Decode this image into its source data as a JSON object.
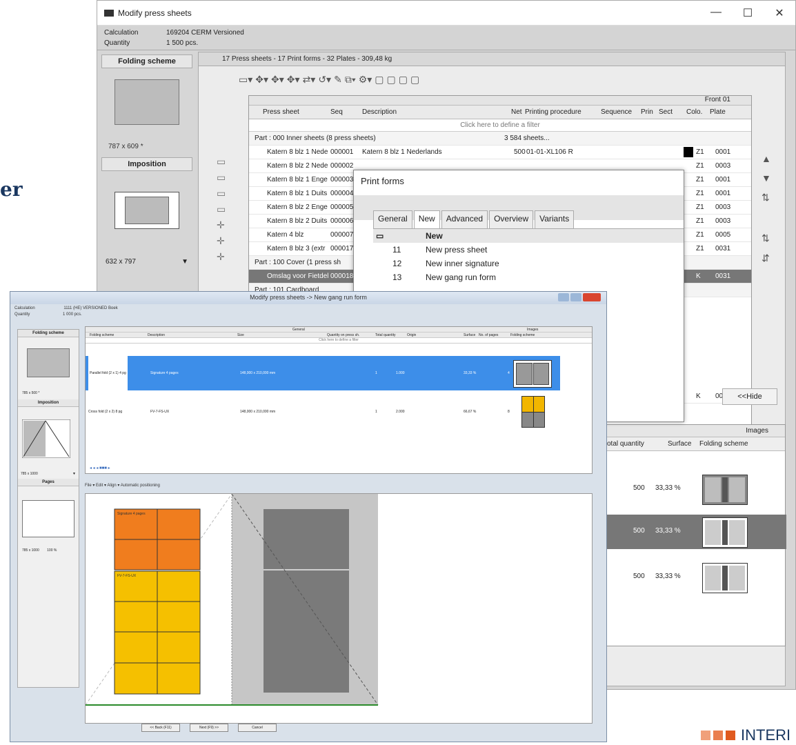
{
  "slide": {
    "partial_heading": "er"
  },
  "brand": {
    "text": "INTERI",
    "colors": [
      "#f0a07a",
      "#ea7f4f",
      "#e05a1f"
    ]
  },
  "back_window": {
    "title": "Modify press sheets",
    "window_controls": [
      "—",
      "☐",
      "✕"
    ],
    "info": {
      "calculation_label": "Calculation",
      "calculation_value": "169204 CERM Versioned",
      "quantity_label": "Quantity",
      "quantity_value": "1 500 pcs."
    },
    "left_panel": {
      "folding_scheme": "Folding scheme",
      "folding_size": "787 x 609 *",
      "imposition": "Imposition",
      "dropdown_value": "632 x 797"
    },
    "summary": "17 Press sheets - 17 Print forms - 32 Plates - 309,48 kg",
    "table": {
      "group_header": "Front 01",
      "columns": [
        "Press sheet",
        "Seq",
        "Description",
        "Net",
        "Printing procedure",
        "Sequence",
        "Prin",
        "Sect",
        "Colo.",
        "Plate"
      ],
      "filter_text": "Click here to define a filter",
      "rows": [
        {
          "type": "part",
          "press_sheet": "Part : 000 Inner sheets (8 press sheets)",
          "net": "3 584 sheets..."
        },
        {
          "press_sheet": "Katern 8 blz 1 Nede",
          "seq": "000001",
          "description": "Katern 8 blz 1 Nederlands",
          "net": "500",
          "procedure": "01-01-XL106 R",
          "color": "Z1",
          "plate": "0001"
        },
        {
          "press_sheet": "Katern 8 blz 2 Nede",
          "seq": "000002",
          "color": "Z1",
          "plate": "0003"
        },
        {
          "press_sheet": "Katern 8 blz 1 Enge",
          "seq": "000003",
          "color": "Z1",
          "plate": "0001"
        },
        {
          "press_sheet": "Katern 8 blz 1 Duits",
          "seq": "000004",
          "color": "Z1",
          "plate": "0001"
        },
        {
          "press_sheet": "Katern 8 blz 2 Enge",
          "seq": "000005",
          "color": "Z1",
          "plate": "0003"
        },
        {
          "press_sheet": "Katern 8 blz 2 Duits",
          "seq": "000006",
          "color": "Z1",
          "plate": "0003"
        },
        {
          "press_sheet": "Katern 4 blz",
          "seq": "000007",
          "color": "Z1",
          "plate": "0005"
        },
        {
          "press_sheet": "Katern 8 blz 3 (extr",
          "seq": "000017",
          "color": "Z1",
          "plate": "0031"
        },
        {
          "type": "part",
          "press_sheet": "Part : 100 Cover (1 press sh"
        },
        {
          "type": "sel",
          "press_sheet": "Omslag voor Fietdel",
          "seq": "000018",
          "color": "K",
          "plate": "0031"
        },
        {
          "type": "part",
          "press_sheet": "Part : 101 Cardboard"
        }
      ],
      "extra_row": {
        "color": "K",
        "plate": "0011"
      }
    },
    "hide_button": "<<Hide",
    "right_panel": {
      "header": "Images",
      "columns": [
        "otal quantity",
        "Surface",
        "Folding scheme"
      ],
      "rows": [
        {
          "quantity": "500",
          "surface": "33,33 %"
        },
        {
          "quantity": "500",
          "surface": "33,33 %"
        },
        {
          "quantity": "500",
          "surface": "33,33 %"
        }
      ]
    }
  },
  "print_forms": {
    "title": "Print forms",
    "tabs": [
      "General",
      "New",
      "Advanced",
      "Overview",
      "Variants"
    ],
    "active_tab": "New",
    "header": "New",
    "items": [
      {
        "num": "11",
        "label": "New press sheet"
      },
      {
        "num": "12",
        "label": "New inner signature"
      },
      {
        "num": "13",
        "label": "New gang run form"
      }
    ]
  },
  "front_window": {
    "title": "Modify press sheets -> New gang run form",
    "info": {
      "calculation_label": "Calculation",
      "calculation_value": "1111 (HE) VERSIONED Boek",
      "quantity_label": "Quantity",
      "quantity_value": "1 000 pcs."
    },
    "left_panel": {
      "folding_scheme": "Folding scheme",
      "size": "785 x 500 *",
      "imposition": "Imposition",
      "dropdown": "785 x 1000",
      "pages": "Pages",
      "pages_size": "785 x 1000",
      "pages_pct": "100 %"
    },
    "grid": {
      "group1": "General",
      "group2": "Images",
      "columns": [
        "Folding scheme",
        "Description",
        "Size",
        "Quantity on press sh.",
        "Total quantity",
        "Origin",
        "Surface",
        "No. of pages",
        "Folding scheme"
      ],
      "filter": "Click here to define a filter",
      "rows": [
        {
          "scheme": "Parallel fold (2 x 1) 4 pg",
          "description": "Signature 4 pages",
          "size": "148,000 x 210,000 mm",
          "qty": "1",
          "total": "1.000",
          "surface": "33,33 %",
          "pages": "4"
        },
        {
          "scheme": "Cross fold (2 x 2) 8 pg",
          "description": "FV-7-FS-UX",
          "size": "148,000 x 210,000 mm",
          "qty": "1",
          "total": "2.000",
          "surface": "66,67 %",
          "pages": "8"
        }
      ]
    },
    "toolbar": [
      "File",
      "Edit",
      "Align",
      "Automatic positioning"
    ],
    "canvas": {
      "block1_label": "Signature 4 pages",
      "block2_label": "FV-7-FS-UX"
    },
    "buttons": [
      "<< Back (F11)",
      "Next (F9) >>",
      "Cancel"
    ]
  }
}
